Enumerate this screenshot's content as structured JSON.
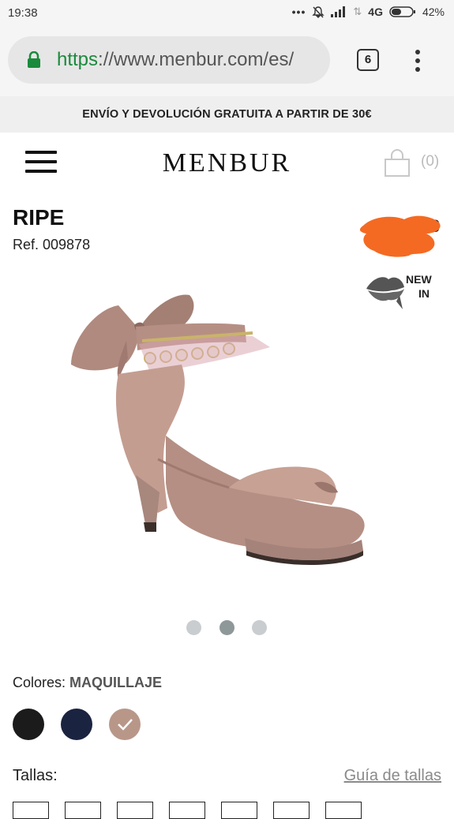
{
  "status_bar": {
    "time": "19:38",
    "network": "4G",
    "battery": "42%"
  },
  "browser": {
    "url_scheme": "https",
    "url_rest": "://www.menbur.com/es/",
    "tab_count": "6"
  },
  "promo": {
    "text": "ENVÍO Y DEVOLUCIÓN GRATUITA A PARTIR DE 30€"
  },
  "header": {
    "logo": "MENBUR",
    "cart_count": "(0)"
  },
  "product": {
    "name": "RIPE",
    "ref": "Ref. 009878",
    "price_visible": "€",
    "badge_line1": "NEW",
    "badge_line2": "IN"
  },
  "gallery": {
    "dot_count": 3,
    "active_dot": 2
  },
  "colors": {
    "label": "Colores:",
    "selected": "MAQUILLAJE",
    "swatches": [
      {
        "name": "black",
        "hex": "#1b1b1b"
      },
      {
        "name": "navy",
        "hex": "#1a2340"
      },
      {
        "name": "maquillaje",
        "hex": "#b89789",
        "selected": true
      }
    ]
  },
  "sizes": {
    "label": "Tallas:",
    "guide_link": "Guía de tallas"
  },
  "theme": {
    "url_green": "#1a8a3c",
    "promo_bg": "#efefef",
    "redaction_orange": "#f46a22"
  }
}
